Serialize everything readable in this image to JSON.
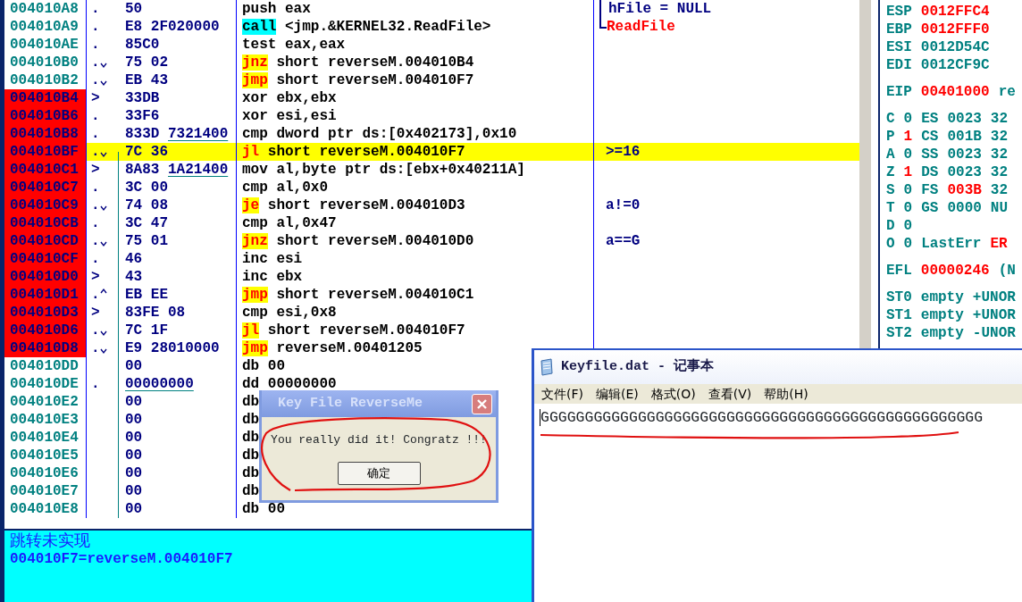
{
  "disassembly": {
    "rows": [
      {
        "address": "004010A8",
        "marked": false,
        "selected": false,
        "marker": ".",
        "hex": "50",
        "fixup": false,
        "mnemonic": {
          "text": "push",
          "kind": "plain"
        },
        "operands": "eax",
        "comment": {
          "text": "hFile = NULL",
          "kind": "arg"
        },
        "bracket": {
          "kind": "mid"
        }
      },
      {
        "address": "004010A9",
        "marked": false,
        "selected": false,
        "marker": ".",
        "hex": "E8 2F020000",
        "fixup": false,
        "mnemonic": {
          "text": "call",
          "kind": "call"
        },
        "operands": "<jmp.&KERNEL32.ReadFile>",
        "comment": {
          "text": "ReadFile",
          "kind": "api"
        },
        "bracket": {
          "kind": "end"
        }
      },
      {
        "address": "004010AE",
        "marked": false,
        "selected": false,
        "marker": ".",
        "hex": "85C0",
        "fixup": false,
        "mnemonic": {
          "text": "test",
          "kind": "plain"
        },
        "operands": "eax,eax"
      },
      {
        "address": "004010B0",
        "marked": false,
        "selected": false,
        "marker": ".",
        "branch": {
          "kind": "down"
        },
        "hex": "75 02",
        "fixup": false,
        "mnemonic": {
          "text": "jnz",
          "kind": "jump"
        },
        "operands": "short reverseM.004010B4"
      },
      {
        "address": "004010B2",
        "marked": false,
        "selected": false,
        "marker": ".",
        "branch": {
          "kind": "down"
        },
        "hex": "EB 43",
        "fixup": false,
        "mnemonic": {
          "text": "jmp",
          "kind": "jump"
        },
        "operands": "short reverseM.004010F7"
      },
      {
        "address": "004010B4",
        "marked": true,
        "selected": false,
        "marker": ">",
        "hex": "33DB",
        "fixup": false,
        "mnemonic": {
          "text": "xor",
          "kind": "plain"
        },
        "operands": "ebx,ebx"
      },
      {
        "address": "004010B6",
        "marked": true,
        "selected": false,
        "marker": ".",
        "hex": "33F6",
        "fixup": false,
        "mnemonic": {
          "text": "xor",
          "kind": "plain"
        },
        "operands": "esi,esi"
      },
      {
        "address": "004010B8",
        "marked": true,
        "selected": false,
        "marker": ".",
        "hex": "833D 7321400",
        "fixup": true,
        "mnemonic": {
          "text": "cmp",
          "kind": "plain"
        },
        "operands": "dword ptr ds:[0x402173],0x10"
      },
      {
        "address": "004010BF",
        "marked": true,
        "selected": true,
        "marker": ".",
        "branch": {
          "kind": "down"
        },
        "jump_line": {
          "kind": "start"
        },
        "hex": "7C 36",
        "fixup": false,
        "mnemonic": {
          "text": "jl",
          "kind": "jump"
        },
        "operands": "short reverseM.004010F7",
        "comment": {
          "text": ">=16",
          "kind": "user"
        }
      },
      {
        "address": "004010C1",
        "marked": true,
        "selected": false,
        "marker": ">",
        "jump_line": {
          "kind": "through"
        },
        "hex": "8A83 1A21400",
        "fixup": true,
        "mnemonic": {
          "text": "mov",
          "kind": "plain"
        },
        "operands": "al,byte ptr ds:[ebx+0x40211A]"
      },
      {
        "address": "004010C7",
        "marked": true,
        "selected": false,
        "marker": ".",
        "jump_line": {
          "kind": "through"
        },
        "hex": "3C 00",
        "fixup": false,
        "mnemonic": {
          "text": "cmp",
          "kind": "plain"
        },
        "operands": "al,0x0"
      },
      {
        "address": "004010C9",
        "marked": true,
        "selected": false,
        "marker": ".",
        "branch": {
          "kind": "down"
        },
        "jump_line": {
          "kind": "through"
        },
        "hex": "74 08",
        "fixup": false,
        "mnemonic": {
          "text": "je",
          "kind": "jump"
        },
        "operands": "short reverseM.004010D3",
        "comment": {
          "text": "a!=0",
          "kind": "user"
        }
      },
      {
        "address": "004010CB",
        "marked": true,
        "selected": false,
        "marker": ".",
        "jump_line": {
          "kind": "through"
        },
        "hex": "3C 47",
        "fixup": false,
        "mnemonic": {
          "text": "cmp",
          "kind": "plain"
        },
        "operands": "al,0x47"
      },
      {
        "address": "004010CD",
        "marked": true,
        "selected": false,
        "marker": ".",
        "branch": {
          "kind": "down"
        },
        "jump_line": {
          "kind": "through"
        },
        "hex": "75 01",
        "fixup": false,
        "mnemonic": {
          "text": "jnz",
          "kind": "jump"
        },
        "operands": "short reverseM.004010D0",
        "comment": {
          "text": "a==G",
          "kind": "user"
        }
      },
      {
        "address": "004010CF",
        "marked": true,
        "selected": false,
        "marker": ".",
        "jump_line": {
          "kind": "through"
        },
        "hex": "46",
        "fixup": false,
        "mnemonic": {
          "text": "inc",
          "kind": "plain"
        },
        "operands": "esi"
      },
      {
        "address": "004010D0",
        "marked": true,
        "selected": false,
        "marker": ">",
        "jump_line": {
          "kind": "through"
        },
        "hex": "43",
        "fixup": false,
        "mnemonic": {
          "text": "inc",
          "kind": "plain"
        },
        "operands": "ebx"
      },
      {
        "address": "004010D1",
        "marked": true,
        "selected": false,
        "marker": ".",
        "branch": {
          "kind": "up"
        },
        "jump_line": {
          "kind": "through"
        },
        "hex": "EB EE",
        "fixup": false,
        "mnemonic": {
          "text": "jmp",
          "kind": "jump"
        },
        "operands": "short reverseM.004010C1"
      },
      {
        "address": "004010D3",
        "marked": true,
        "selected": false,
        "marker": ">",
        "jump_line": {
          "kind": "through"
        },
        "hex": "83FE 08",
        "fixup": false,
        "mnemonic": {
          "text": "cmp",
          "kind": "plain"
        },
        "operands": "esi,0x8"
      },
      {
        "address": "004010D6",
        "marked": true,
        "selected": false,
        "marker": ".",
        "branch": {
          "kind": "down"
        },
        "jump_line": {
          "kind": "through"
        },
        "hex": "7C 1F",
        "fixup": false,
        "mnemonic": {
          "text": "jl",
          "kind": "jump"
        },
        "operands": "short reverseM.004010F7"
      },
      {
        "address": "004010D8",
        "marked": true,
        "selected": false,
        "marker": ".",
        "branch": {
          "kind": "down"
        },
        "jump_line": {
          "kind": "through"
        },
        "hex": "E9 28010000",
        "fixup": false,
        "mnemonic": {
          "text": "jmp",
          "kind": "jump"
        },
        "operands": "reverseM.00401205"
      },
      {
        "address": "004010DD",
        "marked": false,
        "selected": false,
        "jump_line": {
          "kind": "through"
        },
        "hex": "00",
        "fixup": false,
        "mnemonic": {
          "text": "db",
          "kind": "plain"
        },
        "operands": "00"
      },
      {
        "address": "004010DE",
        "marked": false,
        "selected": false,
        "marker": ".",
        "jump_line": {
          "kind": "through"
        },
        "hex": "00000000",
        "fixup": true,
        "mnemonic": {
          "text": "dd",
          "kind": "plain"
        },
        "operands": "00000000"
      },
      {
        "address": "004010E2",
        "marked": false,
        "selected": false,
        "jump_line": {
          "kind": "through"
        },
        "hex": "00",
        "fixup": false,
        "mnemonic": {
          "text": "db",
          "kind": "plain"
        }
      },
      {
        "address": "004010E3",
        "marked": false,
        "selected": false,
        "jump_line": {
          "kind": "through"
        },
        "hex": "00",
        "fixup": false,
        "mnemonic": {
          "text": "db",
          "kind": "plain"
        }
      },
      {
        "address": "004010E4",
        "marked": false,
        "selected": false,
        "jump_line": {
          "kind": "through"
        },
        "hex": "00",
        "fixup": false,
        "mnemonic": {
          "text": "db",
          "kind": "plain"
        }
      },
      {
        "address": "004010E5",
        "marked": false,
        "selected": false,
        "jump_line": {
          "kind": "through"
        },
        "hex": "00",
        "fixup": false,
        "mnemonic": {
          "text": "db",
          "kind": "plain"
        }
      },
      {
        "address": "004010E6",
        "marked": false,
        "selected": false,
        "jump_line": {
          "kind": "through"
        },
        "hex": "00",
        "fixup": false,
        "mnemonic": {
          "text": "db",
          "kind": "plain"
        }
      },
      {
        "address": "004010E7",
        "marked": false,
        "selected": false,
        "jump_line": {
          "kind": "through"
        },
        "hex": "00",
        "fixup": false,
        "mnemonic": {
          "text": "db",
          "kind": "plain"
        }
      },
      {
        "address": "004010E8",
        "marked": false,
        "selected": false,
        "jump_line": {
          "kind": "through"
        },
        "hex": "00",
        "fixup": false,
        "mnemonic": {
          "text": "db",
          "kind": "plain"
        },
        "operands": "00"
      }
    ]
  },
  "info_pane": {
    "lines": [
      "跳转未实现",
      "004010F7=reverseM.004010F7"
    ]
  },
  "registers": {
    "groups": [
      {
        "lines": [
          [
            {
              "text": "ESP",
              "kind": "label"
            },
            {
              "text": "0012FFC4",
              "kind": "changed"
            }
          ],
          [
            {
              "text": "EBP",
              "kind": "label"
            },
            {
              "text": "0012FFF0",
              "kind": "changed"
            }
          ],
          [
            {
              "text": "ESI",
              "kind": "label"
            },
            {
              "text": "0012D54C",
              "kind": "value"
            }
          ],
          [
            {
              "text": "EDI",
              "kind": "label"
            },
            {
              "text": "0012CF9C",
              "kind": "value"
            }
          ]
        ]
      },
      {
        "lines": [
          [
            {
              "text": "EIP",
              "kind": "label"
            },
            {
              "text": "00401000",
              "kind": "changed"
            },
            {
              "text": "re",
              "kind": "value"
            }
          ]
        ]
      },
      {
        "lines": [
          [
            {
              "text": "C",
              "kind": "label"
            },
            {
              "text": "0",
              "kind": "value"
            },
            {
              "text": "ES",
              "kind": "label"
            },
            {
              "text": "0023",
              "kind": "value"
            },
            {
              "text": "32",
              "kind": "value"
            }
          ],
          [
            {
              "text": "P",
              "kind": "label"
            },
            {
              "text": "1",
              "kind": "changed"
            },
            {
              "text": "CS",
              "kind": "label"
            },
            {
              "text": "001B",
              "kind": "value"
            },
            {
              "text": "32",
              "kind": "value"
            }
          ],
          [
            {
              "text": "A",
              "kind": "label"
            },
            {
              "text": "0",
              "kind": "value"
            },
            {
              "text": "SS",
              "kind": "label"
            },
            {
              "text": "0023",
              "kind": "value"
            },
            {
              "text": "32",
              "kind": "value"
            }
          ],
          [
            {
              "text": "Z",
              "kind": "label"
            },
            {
              "text": "1",
              "kind": "changed"
            },
            {
              "text": "DS",
              "kind": "label"
            },
            {
              "text": "0023",
              "kind": "value"
            },
            {
              "text": "32",
              "kind": "value"
            }
          ],
          [
            {
              "text": "S",
              "kind": "label"
            },
            {
              "text": "0",
              "kind": "value"
            },
            {
              "text": "FS",
              "kind": "label"
            },
            {
              "text": "003B",
              "kind": "changed"
            },
            {
              "text": "32",
              "kind": "value"
            }
          ],
          [
            {
              "text": "T",
              "kind": "label"
            },
            {
              "text": "0",
              "kind": "value"
            },
            {
              "text": "GS",
              "kind": "label"
            },
            {
              "text": "0000",
              "kind": "value"
            },
            {
              "text": "NU",
              "kind": "value"
            }
          ],
          [
            {
              "text": "D",
              "kind": "label"
            },
            {
              "text": "0",
              "kind": "value"
            }
          ],
          [
            {
              "text": "O",
              "kind": "label"
            },
            {
              "text": "0",
              "kind": "value"
            },
            {
              "text": "LastErr",
              "kind": "label"
            },
            {
              "text": "ER",
              "kind": "changed"
            }
          ]
        ]
      },
      {
        "lines": [
          [
            {
              "text": "EFL",
              "kind": "label"
            },
            {
              "text": "00000246",
              "kind": "changed"
            },
            {
              "text": "(N",
              "kind": "value"
            }
          ]
        ]
      },
      {
        "lines": [
          [
            {
              "text": "ST0",
              "kind": "label"
            },
            {
              "text": "empty",
              "kind": "value"
            },
            {
              "text": "+UNOR",
              "kind": "value"
            }
          ],
          [
            {
              "text": "ST1",
              "kind": "label"
            },
            {
              "text": "empty",
              "kind": "value"
            },
            {
              "text": "+UNOR",
              "kind": "value"
            }
          ],
          [
            {
              "text": "ST2",
              "kind": "label"
            },
            {
              "text": "empty",
              "kind": "value"
            },
            {
              "text": "-UNOR",
              "kind": "value"
            }
          ]
        ]
      }
    ]
  },
  "message_box": {
    "title": "Key File ReverseMe",
    "message": "You really did it! Congratz !!!",
    "button": "确定"
  },
  "notepad": {
    "title": "Keyfile.dat - 记事本",
    "menu": [
      "文件(F)",
      "编辑(E)",
      "格式(O)",
      "查看(V)",
      "帮助(H)"
    ],
    "text": "GGGGGGGGGGGGGGGGGGGGGGGGGGGGGGGGGGGGGGGGGGGGGGGGGG"
  }
}
